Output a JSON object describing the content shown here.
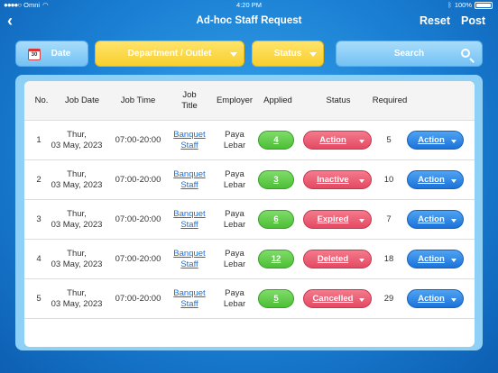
{
  "statusbar": {
    "carrier": "Omni",
    "time": "4:20 PM",
    "battery": "100%"
  },
  "nav": {
    "title": "Ad-hoc Staff Request",
    "reset": "Reset",
    "post": "Post"
  },
  "filters": {
    "date": "Date",
    "calendar_day": "30",
    "department": "Department / Outlet",
    "status": "Status",
    "search": "Search"
  },
  "table": {
    "headers": {
      "no": "No.",
      "job_date": "Job Date",
      "job_time": "Job Time",
      "job_title_1": "Job",
      "job_title_2": "Title",
      "employer": "Employer",
      "applied": "Applied",
      "status": "Status",
      "required": "Required"
    },
    "rows": [
      {
        "no": "1",
        "day": "Thur,",
        "date": "03 May, 2023",
        "time": "07:00-20:00",
        "title1": "Banquet",
        "title2": "Staff",
        "emp1": "Paya",
        "emp2": "Lebar",
        "applied": "4",
        "status": "Action",
        "required": "5",
        "action": "Action"
      },
      {
        "no": "2",
        "day": "Thur,",
        "date": "03 May, 2023",
        "time": "07:00-20:00",
        "title1": "Banquet",
        "title2": "Staff",
        "emp1": "Paya",
        "emp2": "Lebar",
        "applied": "3",
        "status": "Inactive",
        "required": "10",
        "action": "Action"
      },
      {
        "no": "3",
        "day": "Thur,",
        "date": "03 May, 2023",
        "time": "07:00-20:00",
        "title1": "Banquet",
        "title2": "Staff",
        "emp1": "Paya",
        "emp2": "Lebar",
        "applied": "6",
        "status": "Expired",
        "required": "7",
        "action": "Action"
      },
      {
        "no": "4",
        "day": "Thur,",
        "date": "03 May, 2023",
        "time": "07:00-20:00",
        "title1": "Banquet",
        "title2": "Staff",
        "emp1": "Paya",
        "emp2": "Lebar",
        "applied": "12",
        "status": "Deleted",
        "required": "18",
        "action": "Action"
      },
      {
        "no": "5",
        "day": "Thur,",
        "date": "03 May, 2023",
        "time": "07:00-20:00",
        "title1": "Banquet",
        "title2": "Staff",
        "emp1": "Paya",
        "emp2": "Lebar",
        "applied": "5",
        "status": "Cancelled",
        "required": "29",
        "action": "Action"
      }
    ]
  },
  "colors": {
    "applied": "#4cbf36",
    "status": "#e34a62",
    "action": "#1c72d9",
    "filter_yellow": "#f8cf2e",
    "filter_blue": "#74c2f5"
  }
}
